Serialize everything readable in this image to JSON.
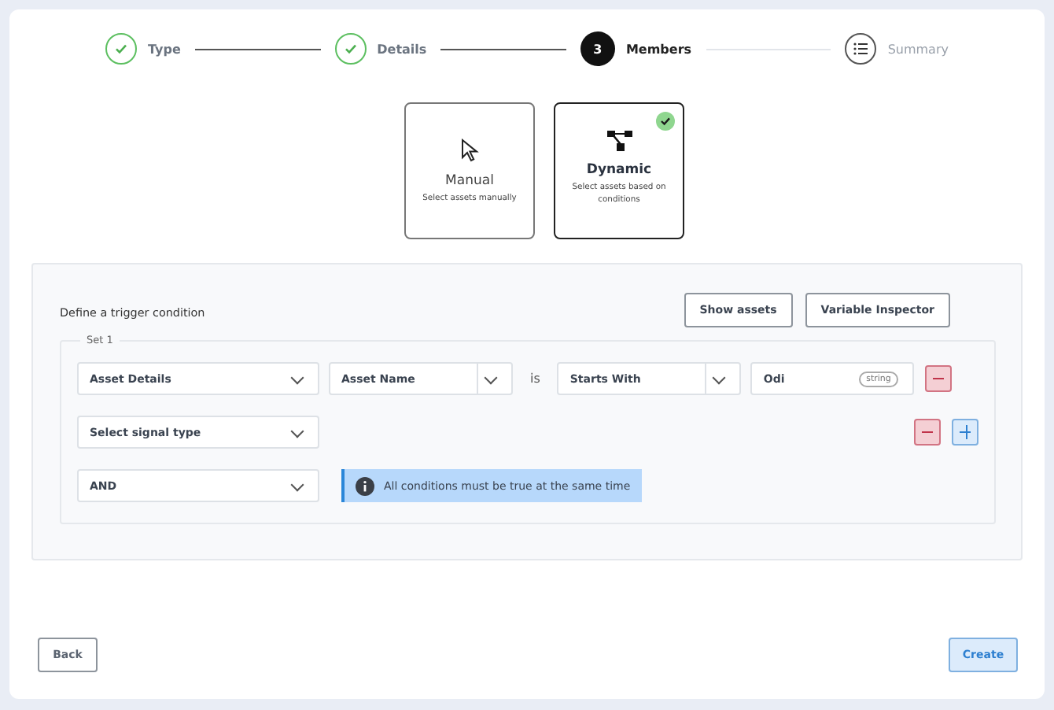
{
  "steps": [
    {
      "label": "Type",
      "done": true,
      "current": false
    },
    {
      "label": "Details",
      "done": true,
      "current": false
    },
    {
      "label": "Members",
      "done": false,
      "current": true,
      "number": "3"
    },
    {
      "label": "Summary",
      "done": false,
      "current": false
    }
  ],
  "modes": [
    {
      "kind": "manual",
      "title": "Manual",
      "description": "Select assets manually",
      "selected": false
    },
    {
      "kind": "dynamic",
      "title": "Dynamic",
      "description": "Select assets based on conditions",
      "selected": true
    }
  ],
  "condition": {
    "heading": "Define a trigger condition",
    "buttons": [
      "Show assets",
      "Variable Inspector"
    ],
    "set": {
      "legend": "Set 1",
      "row_1": {
        "category": "Asset Details",
        "field": "Asset Name",
        "operator_word": "is",
        "operator": "Starts With",
        "value": "Odi",
        "value_type": "string"
      },
      "row_2": {
        "placeholder": "Select signal type"
      },
      "logic": {
        "value": "AND",
        "info": "All conditions must be true at the same time"
      }
    }
  },
  "footer": {
    "back": "Back",
    "create": "Create"
  }
}
